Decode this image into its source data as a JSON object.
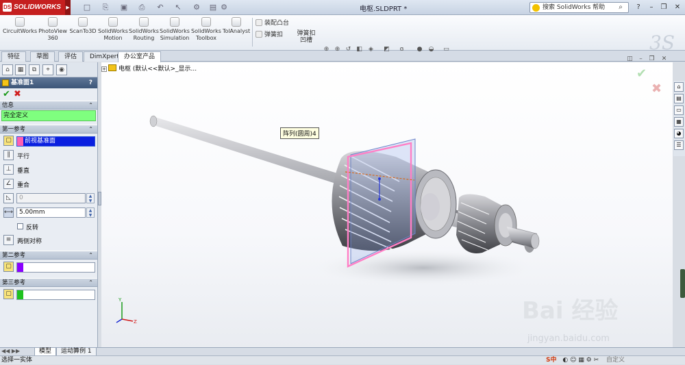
{
  "app": {
    "logo_text": "SOLIDWORKS",
    "document_title": "电枢.SLDPRT *"
  },
  "help_search": {
    "placeholder": "搜索 SolidWorks 帮助"
  },
  "commands": [
    {
      "label": "CircuitWorks"
    },
    {
      "label": "PhotoView\n360"
    },
    {
      "label": "ScanTo3D"
    },
    {
      "label": "SolidWorks\nMotion"
    },
    {
      "label": "SolidWorks\nRouting"
    },
    {
      "label": "SolidWorks\nSimulation"
    },
    {
      "label": "SolidWorks\nToolbox"
    },
    {
      "label": "TolAnalyst"
    }
  ],
  "commands_right": {
    "assemble_boss": "装配凸台",
    "snap_hook": "弹簧扣",
    "snap_hook_groove": "弹簧扣\n凹槽"
  },
  "tabs": [
    {
      "label": "特征"
    },
    {
      "label": "草图"
    },
    {
      "label": "评估"
    },
    {
      "label": "DimXpert"
    },
    {
      "label": "办公室产品"
    }
  ],
  "property_manager": {
    "title": "基准面1",
    "help": "?",
    "info_header": "信息",
    "info_status": "完全定义",
    "first_ref": {
      "header": "第一参考",
      "selection": "前视基准面",
      "options": [
        "平行",
        "垂直",
        "重合"
      ],
      "angle_value": "0",
      "distance_value": "5.00mm",
      "flip_label": "反转",
      "symmetric_label": "两侧对称"
    },
    "second_ref": {
      "header": "第二参考",
      "color": "#8a00ff"
    },
    "third_ref": {
      "header": "第三参考",
      "color": "#1fc21f"
    },
    "first_ref_color": "#ff5fb0"
  },
  "feature_tree": {
    "root": "电枢  (默认<<默认>_显示..."
  },
  "tooltip": "阵列(圆周)4",
  "bottom_tabs": [
    {
      "label": "模型"
    },
    {
      "label": "运动算例 1"
    }
  ],
  "status": {
    "message": "选择一实体"
  },
  "tray": {
    "ime": "S中",
    "custom_label": "自定义"
  },
  "watermark": {
    "main": "Bai 经验",
    "sub": "jingyan.baidu.com"
  },
  "colors": {
    "brand_red": "#c51f1f",
    "ok_green": "#1b9a1b",
    "cancel_red": "#d01f1f",
    "plane_pink": "#ff7fc6",
    "plane_blue": "#8fa9e8"
  }
}
